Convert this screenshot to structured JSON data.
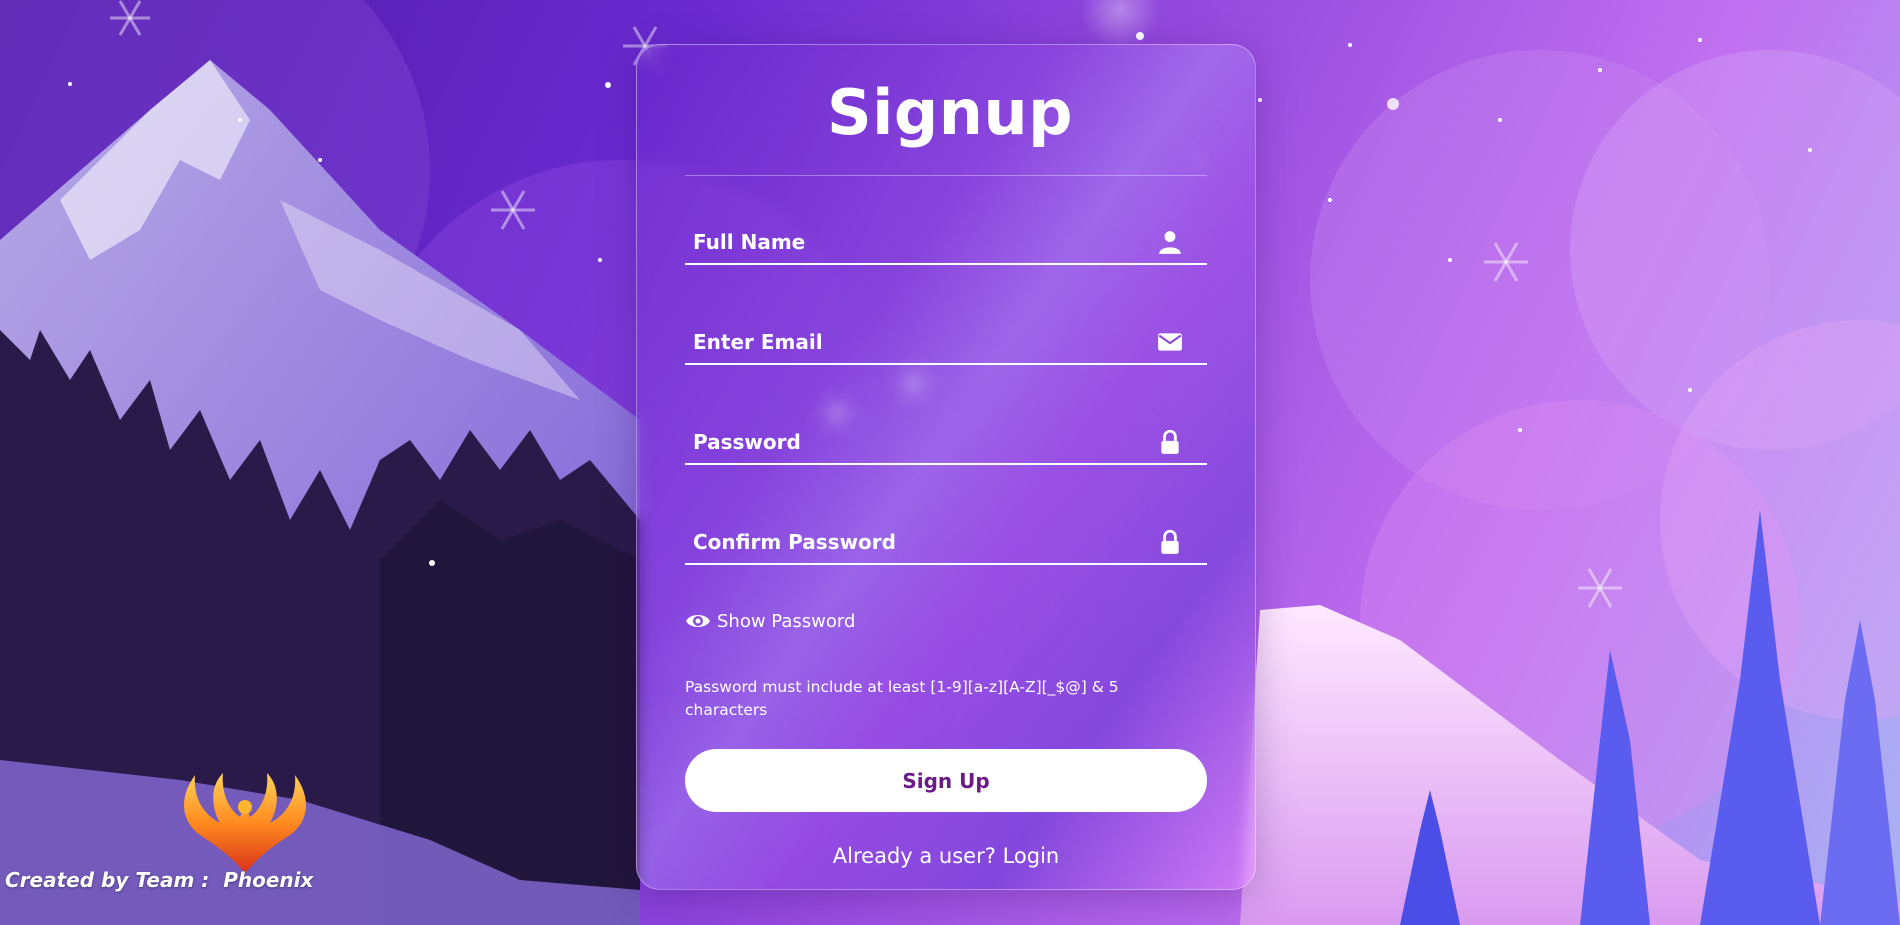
{
  "form": {
    "title": "Signup",
    "fields": [
      {
        "name": "full-name",
        "placeholder": "Full Name",
        "value": "",
        "icon": "user-icon"
      },
      {
        "name": "email",
        "placeholder": "Enter Email",
        "value": "",
        "icon": "envelope-icon"
      },
      {
        "name": "password",
        "placeholder": "Password",
        "value": "",
        "icon": "lock-icon"
      },
      {
        "name": "confirm-password",
        "placeholder": "Confirm Password",
        "value": "",
        "icon": "lock-icon"
      }
    ],
    "show_password_label": "Show Password",
    "show_password_icon": "eye-icon",
    "hint": "Password must include at least [1-9][a-z][A-Z][_$@] & 5 characters",
    "submit_label": "Sign Up",
    "login_prompt": "Already a user?",
    "login_link": "Login"
  },
  "footer": {
    "credit_prefix": "Created by Team :",
    "team_name": "Phoenix",
    "logo_icon": "phoenix-logo"
  },
  "colors": {
    "button_text": "#6a1b86",
    "button_bg": "#ffffff",
    "text": "#ffffff"
  }
}
